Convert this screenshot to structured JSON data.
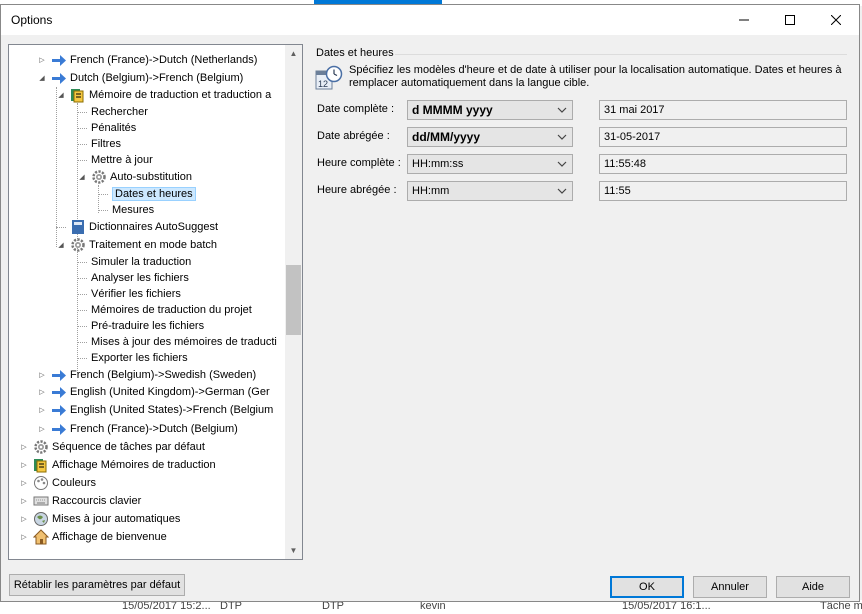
{
  "window": {
    "title": "Options"
  },
  "tree": {
    "nodes": [
      {
        "label": "French (France)->Dutch (Netherlands)",
        "icon": "arrow-right-icon"
      },
      {
        "label": "Dutch (Belgium)->French (Belgium)",
        "icon": "arrow-right-icon"
      },
      {
        "label": "Mémoire de traduction et traduction a",
        "icon": "tm-icon"
      },
      {
        "label": "Rechercher"
      },
      {
        "label": "Pénalités"
      },
      {
        "label": "Filtres"
      },
      {
        "label": "Mettre à jour"
      },
      {
        "label": "Auto-substitution",
        "icon": "gear-icon"
      },
      {
        "label": "Dates et heures"
      },
      {
        "label": "Mesures"
      },
      {
        "label": "Dictionnaires AutoSuggest",
        "icon": "dictionary-icon"
      },
      {
        "label": "Traitement en mode batch",
        "icon": "gear-icon"
      },
      {
        "label": "Simuler la traduction"
      },
      {
        "label": "Analyser les fichiers"
      },
      {
        "label": "Vérifier les fichiers"
      },
      {
        "label": "Mémoires de traduction du projet"
      },
      {
        "label": "Pré-traduire les fichiers"
      },
      {
        "label": "Mises à jour des mémoires de traducti"
      },
      {
        "label": "Exporter les fichiers"
      },
      {
        "label": "French (Belgium)->Swedish (Sweden)",
        "icon": "arrow-right-icon"
      },
      {
        "label": "English (United Kingdom)->German (Ger",
        "icon": "arrow-right-icon"
      },
      {
        "label": "English (United States)->French (Belgium",
        "icon": "arrow-right-icon"
      },
      {
        "label": "French (France)->Dutch (Belgium)",
        "icon": "arrow-right-icon"
      },
      {
        "label": "Séquence de tâches par défaut",
        "icon": "gear-icon"
      },
      {
        "label": "Affichage Mémoires de traduction",
        "icon": "tm-icon"
      },
      {
        "label": "Couleurs",
        "icon": "palette-icon"
      },
      {
        "label": "Raccourcis clavier",
        "icon": "keyboard-icon"
      },
      {
        "label": "Mises à jour automatiques",
        "icon": "globe-icon"
      },
      {
        "label": "Affichage de bienvenue",
        "icon": "home-icon"
      }
    ]
  },
  "panel": {
    "group_title": "Dates et heures",
    "description": "Spécifiez les modèles d'heure et de date à utiliser pour la localisation automatique. Dates et heures à remplacer automatiquement dans la langue cible.",
    "rows": [
      {
        "label": "Date complète :",
        "pattern": "d MMMM yyyy",
        "preview": "31 mai 2017"
      },
      {
        "label": "Date abrégée :",
        "pattern": "dd/MM/yyyy",
        "preview": "31-05-2017"
      },
      {
        "label": "Heure complète :",
        "pattern": "HH:mm:ss",
        "preview": "11:55:48"
      },
      {
        "label": "Heure abrégée :",
        "pattern": "HH:mm",
        "preview": "11:55"
      }
    ]
  },
  "buttons": {
    "reset": "Rétablir les paramètres par défaut",
    "ok": "OK",
    "cancel": "Annuler",
    "help": "Aide"
  },
  "background": {
    "bottom_cells": [
      "15/05/2017 15:2...",
      "DTP",
      "DTP",
      "kevin",
      "15/05/2017 16:1...",
      "Tâche m"
    ]
  },
  "colors": {
    "selection": "#cce8ff",
    "accent": "#0078d7",
    "arrow": "#3a7bd5"
  }
}
